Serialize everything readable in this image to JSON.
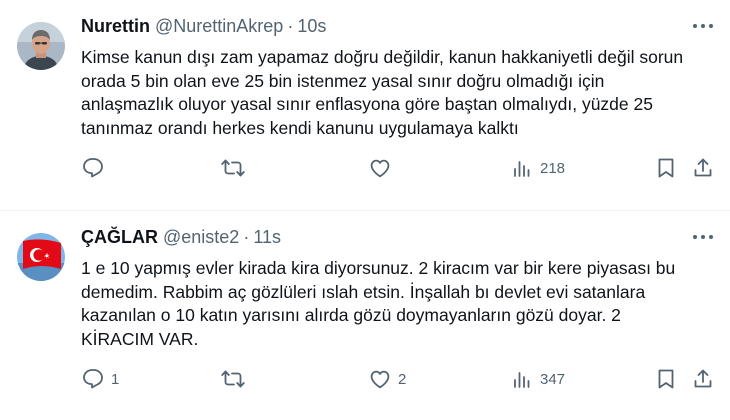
{
  "tweets": [
    {
      "name": "Nurettin",
      "handle": "@NurettinAkrep",
      "separator": "·",
      "time": "10s",
      "text": "Kimse kanun dışı zam yapamaz doğru değildir, kanun hakkaniyetli değil sorun orada 5 bin olan eve 25 bin istenmez yasal sınır doğru olmadığı için anlaşmazlık oluyor yasal sınır enflasyona göre baştan olmalıydı, yüzde 25 tanınmaz orandı herkes kendi  kanunu uygulamaya kalktı",
      "reply_count": "",
      "retweet_count": "",
      "like_count": "",
      "view_count": "218"
    },
    {
      "name": "ÇAĞLAR",
      "handle": "@eniste2",
      "separator": "·",
      "time": "11s",
      "text": "1 e 10 yapmış evler kirada kira diyorsunuz. 2 kiracım var bir kere piyasası bu demedim. Rabbim aç gözlüleri ıslah etsin. İnşallah bı devlet evi satanlara kazanılan o 10 katın yarısını alırda gözü doymayanların gözü doyar. 2 KİRACIM VAR.",
      "reply_count": "1",
      "retweet_count": "",
      "like_count": "2",
      "view_count": "347"
    }
  ],
  "icons": {
    "reply": "reply-icon",
    "retweet": "retweet-icon",
    "like": "heart-icon",
    "views": "views-icon",
    "bookmark": "bookmark-icon",
    "share": "share-icon",
    "more": "more-icon"
  },
  "colors": {
    "text_primary": "#0f1419",
    "text_secondary": "#536471",
    "divider": "#eff3f4",
    "flag_red": "#e30a17"
  }
}
